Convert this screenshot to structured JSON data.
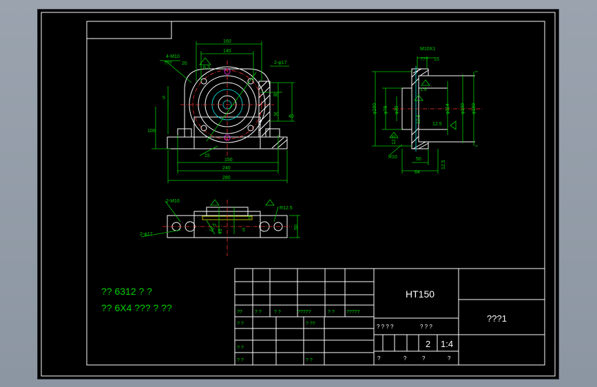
{
  "notes": {
    "line1": "?? 6312 ? ?",
    "line2": "?? 6X4 ???  ? ??"
  },
  "title_block": {
    "material": "HT150",
    "drawing_name": "???1",
    "quantity": "2",
    "scale": "1:4",
    "cells": {
      "r5_c1": "??",
      "r5_c2": "? ?",
      "r5_c3": "?  ?",
      "r5_c4": "?????",
      "r5_c5": "?  ?",
      "r5_c6": "?????",
      "r6_c1": "?  ?",
      "r6_c2": "? ??",
      "r8_c1": "?  ?",
      "r9_c1": "?  ?",
      "r9_c2": "?  ?",
      "mid1": "?  ?  ?  ?",
      "mid2": "?  ?  ?",
      "bot1": "?",
      "bot2": "?",
      "bot3": "?",
      "bot4": "?"
    }
  },
  "front_view": {
    "dims": {
      "d160": "160",
      "d140": "140",
      "m10": "4-M10",
      "q": "???",
      "d20": "20",
      "phi17": "2-φ17",
      "d5": "5",
      "d100": "100",
      "d150": "150",
      "d240": "240",
      "d280": "280",
      "d80": "80",
      "d30": "30",
      "d40": "40",
      "d15": "15",
      "r63a": "6.3"
    }
  },
  "side_view": {
    "dims": {
      "m10x1": "M10X1",
      "q3": "???",
      "d15": "15",
      "d16": "1.6",
      "d160": "φ160",
      "d78": "φ78",
      "d30": "φ30",
      "d114": "φ114",
      "d130": "φ130",
      "d180": "φ180",
      "d125a": "12.5",
      "d125b": "12.5",
      "d125c": "12.5",
      "r10": "R10",
      "d50": "50",
      "d64": "64",
      "d125d": "12.5"
    }
  },
  "top_view": {
    "dims": {
      "m16": "2-M16",
      "phi17": "2-φ17",
      "r125": "R12.5",
      "d50": "50",
      "d5": "5",
      "d45": "45",
      "d125": "12.5",
      "d5b": "5"
    }
  }
}
